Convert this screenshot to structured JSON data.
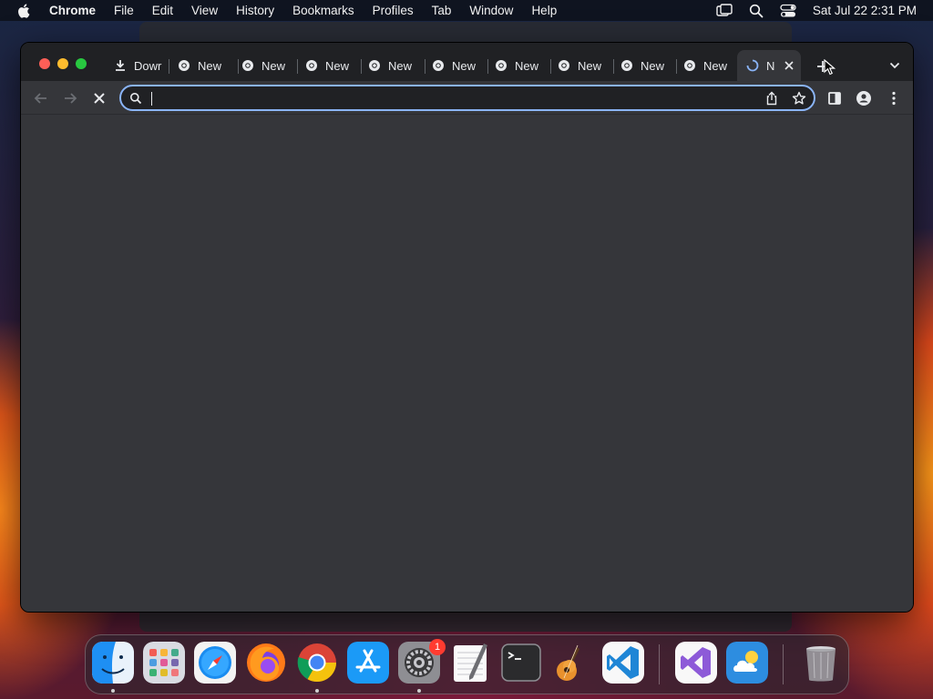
{
  "menubar": {
    "app": "Chrome",
    "items": [
      "File",
      "Edit",
      "View",
      "History",
      "Bookmarks",
      "Profiles",
      "Tab",
      "Window",
      "Help"
    ],
    "clock": "Sat Jul 22  2:31 PM",
    "icons": [
      "apple-icon",
      "screen-mirroring-icon",
      "spotlight-search-icon",
      "control-center-icon"
    ]
  },
  "browser": {
    "tabs": [
      {
        "label": "Dowr",
        "icon": "download-icon"
      },
      {
        "label": "New",
        "icon": "chrome-icon"
      },
      {
        "label": "New",
        "icon": "chrome-icon"
      },
      {
        "label": "New",
        "icon": "chrome-icon"
      },
      {
        "label": "New",
        "icon": "chrome-icon"
      },
      {
        "label": "New",
        "icon": "chrome-icon"
      },
      {
        "label": "New",
        "icon": "chrome-icon"
      },
      {
        "label": "New",
        "icon": "chrome-icon"
      },
      {
        "label": "New",
        "icon": "chrome-icon"
      },
      {
        "label": "New",
        "icon": "chrome-icon"
      },
      {
        "label": "N",
        "icon": "loading-spinner-icon",
        "active": true
      }
    ],
    "omnibox": {
      "value": "",
      "placeholder": ""
    },
    "accent": "#8ab4f8",
    "theme": "dark"
  },
  "dock": {
    "apps": [
      {
        "name": "Finder",
        "icon": "finder-icon",
        "running": true
      },
      {
        "name": "Launchpad",
        "icon": "launchpad-icon"
      },
      {
        "name": "Safari",
        "icon": "safari-icon"
      },
      {
        "name": "Firefox",
        "icon": "firefox-icon"
      },
      {
        "name": "Chrome",
        "icon": "chrome-icon",
        "running": true
      },
      {
        "name": "App Store",
        "icon": "app-store-icon"
      },
      {
        "name": "System Settings",
        "icon": "system-settings-icon",
        "running": true,
        "badge": "1"
      },
      {
        "name": "TextEdit",
        "icon": "textedit-icon"
      },
      {
        "name": "Terminal",
        "icon": "terminal-icon"
      },
      {
        "name": "GarageBand",
        "icon": "garageband-icon"
      },
      {
        "name": "Visual Studio Code",
        "icon": "vscode-icon"
      },
      {
        "name": "Visual Studio",
        "icon": "visual-studio-icon"
      },
      {
        "name": "Weather",
        "icon": "weather-icon"
      },
      {
        "name": "Trash",
        "icon": "trash-icon"
      }
    ]
  }
}
